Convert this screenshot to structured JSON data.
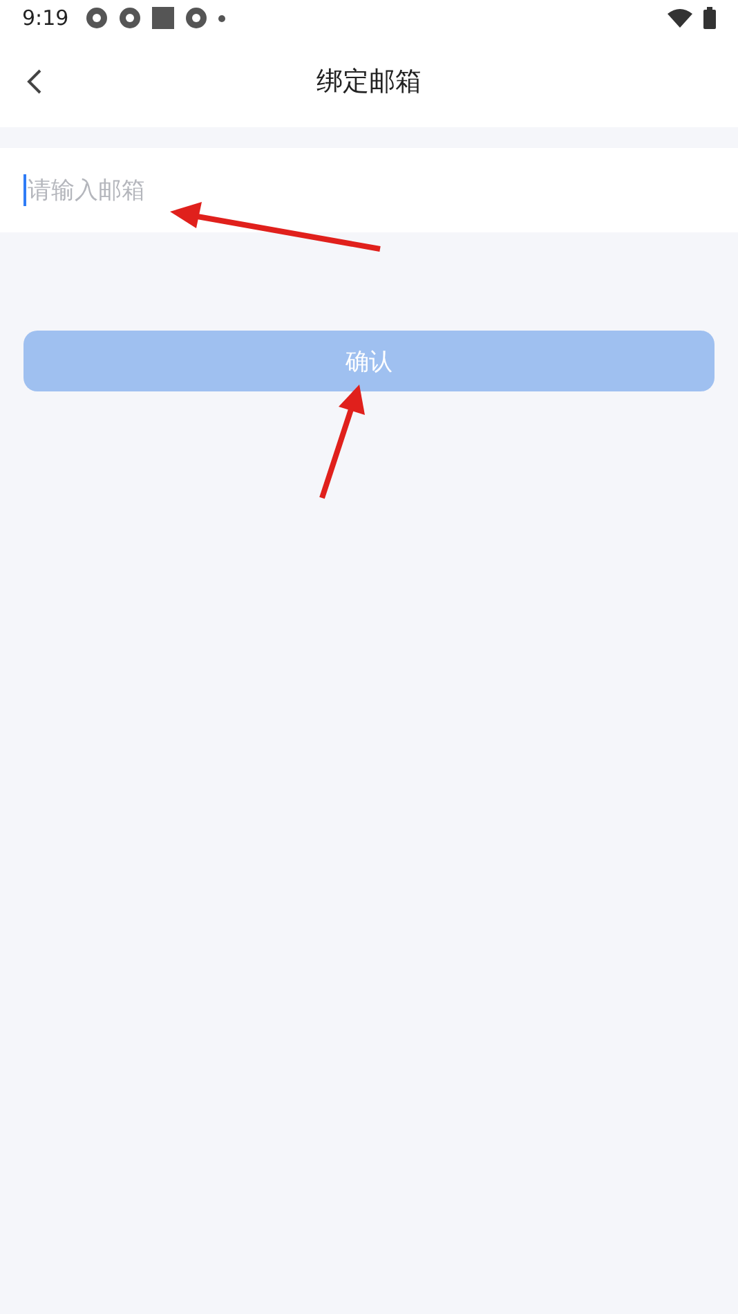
{
  "status_bar": {
    "time": "9:19"
  },
  "header": {
    "title": "绑定邮箱"
  },
  "email_field": {
    "placeholder": "请输入邮箱",
    "focused": true
  },
  "confirm_button": {
    "label": "确认",
    "disabled": true
  }
}
